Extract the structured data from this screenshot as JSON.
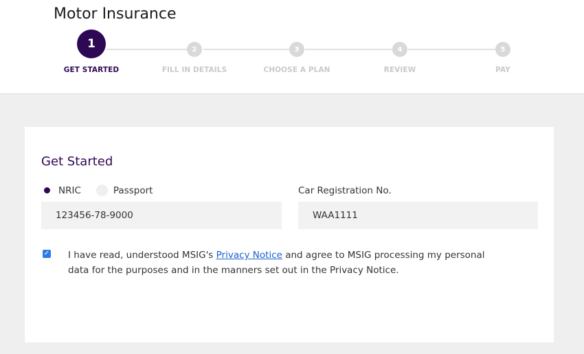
{
  "header": {
    "title": "Motor Insurance"
  },
  "stepper": {
    "steps": [
      {
        "number": "1",
        "label": "GET STARTED",
        "state": "active"
      },
      {
        "number": "2",
        "label": "FILL IN DETAILS",
        "state": "inactive"
      },
      {
        "number": "3",
        "label": "CHOOSE A PLAN",
        "state": "inactive"
      },
      {
        "number": "4",
        "label": "REVIEW",
        "state": "inactive"
      },
      {
        "number": "5",
        "label": "PAY",
        "state": "inactive"
      }
    ]
  },
  "form": {
    "title": "Get Started",
    "id_type": {
      "options": [
        {
          "label": "NRIC",
          "checked": true
        },
        {
          "label": "Passport",
          "checked": false
        }
      ]
    },
    "id_value": "123456-78-9000",
    "car_reg": {
      "label": "Car Registration No.",
      "value": "WAA1111"
    },
    "consent": {
      "checked": true,
      "text_before": "I have read, understood MSIG's ",
      "link_text": "Privacy Notice",
      "text_after": " and agree to MSIG processing my personal data for the purposes and in the manners set out in the Privacy Notice."
    }
  },
  "colors": {
    "accent": "#2e0854",
    "inactive_step": "#d9d9d9",
    "link": "#1a5fd0",
    "checkbox": "#2d7be6"
  }
}
